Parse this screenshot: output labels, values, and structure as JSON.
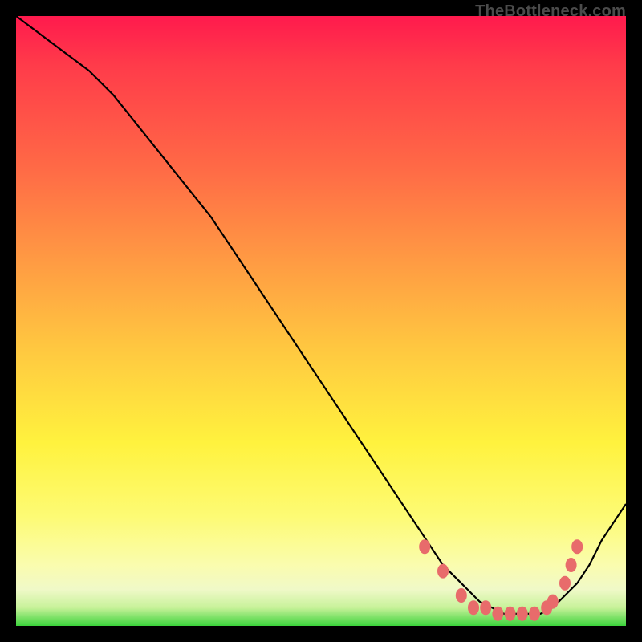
{
  "attribution": "TheBottleneck.com",
  "colors": {
    "background": "#000000",
    "gradient_top": "#ff1a4d",
    "gradient_bottom": "#3bd33b",
    "curve": "#000000",
    "marker": "#e86b6b"
  },
  "chart_data": {
    "type": "line",
    "title": "",
    "xlabel": "",
    "ylabel": "",
    "xlim": [
      0,
      100
    ],
    "ylim": [
      0,
      100
    ],
    "grid": false,
    "legend": false,
    "series": [
      {
        "name": "curve",
        "x": [
          0,
          4,
          8,
          12,
          16,
          20,
          24,
          28,
          32,
          36,
          40,
          44,
          48,
          52,
          56,
          60,
          64,
          68,
          70,
          72,
          74,
          76,
          78,
          80,
          82,
          84,
          86,
          88,
          90,
          92,
          94,
          96,
          98,
          100
        ],
        "y": [
          100,
          97,
          94,
          91,
          87,
          82,
          77,
          72,
          67,
          61,
          55,
          49,
          43,
          37,
          31,
          25,
          19,
          13,
          10,
          8,
          6,
          4,
          3,
          2,
          2,
          2,
          2,
          3,
          5,
          7,
          10,
          14,
          17,
          20
        ]
      }
    ],
    "markers": [
      {
        "x": 67,
        "y": 13
      },
      {
        "x": 70,
        "y": 9
      },
      {
        "x": 73,
        "y": 5
      },
      {
        "x": 75,
        "y": 3
      },
      {
        "x": 77,
        "y": 3
      },
      {
        "x": 79,
        "y": 2
      },
      {
        "x": 81,
        "y": 2
      },
      {
        "x": 83,
        "y": 2
      },
      {
        "x": 85,
        "y": 2
      },
      {
        "x": 87,
        "y": 3
      },
      {
        "x": 88,
        "y": 4
      },
      {
        "x": 90,
        "y": 7
      },
      {
        "x": 91,
        "y": 10
      },
      {
        "x": 92,
        "y": 13
      }
    ]
  }
}
